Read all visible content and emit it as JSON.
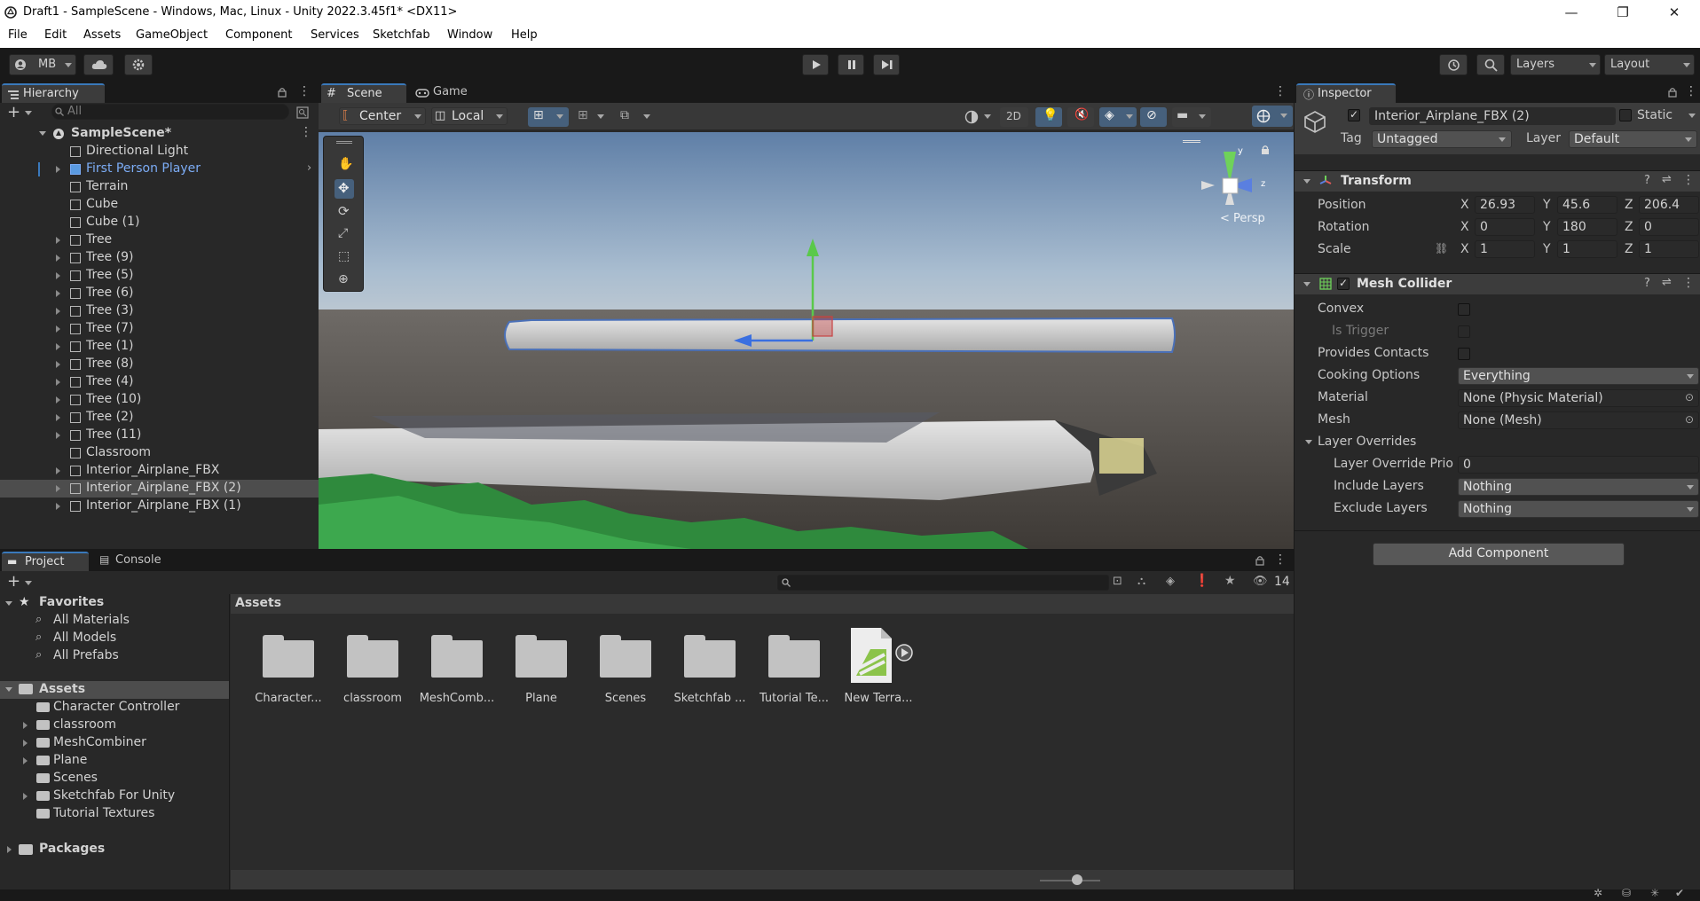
{
  "window": {
    "title": "Draft1 - SampleScene - Windows, Mac, Linux - Unity 2022.3.45f1* <DX11>"
  },
  "menu": [
    "File",
    "Edit",
    "Assets",
    "GameObject",
    "Component",
    "Services",
    "Sketchfab",
    "Window",
    "Help"
  ],
  "toolbar": {
    "account": "MB",
    "layers": "Layers",
    "layout": "Layout"
  },
  "hierarchy": {
    "tab": "Hierarchy",
    "search_placeholder": "All",
    "scene": "SampleScene*",
    "items": [
      {
        "label": "Directional Light",
        "arrow": false
      },
      {
        "label": "First Person Player",
        "arrow": true,
        "prefab": true
      },
      {
        "label": "Terrain",
        "arrow": false
      },
      {
        "label": "Cube",
        "arrow": false
      },
      {
        "label": "Cube (1)",
        "arrow": false
      },
      {
        "label": "Tree",
        "arrow": true
      },
      {
        "label": "Tree (9)",
        "arrow": true
      },
      {
        "label": "Tree (5)",
        "arrow": true
      },
      {
        "label": "Tree (6)",
        "arrow": true
      },
      {
        "label": "Tree (3)",
        "arrow": true
      },
      {
        "label": "Tree (7)",
        "arrow": true
      },
      {
        "label": "Tree (1)",
        "arrow": true
      },
      {
        "label": "Tree (8)",
        "arrow": true
      },
      {
        "label": "Tree (4)",
        "arrow": true
      },
      {
        "label": "Tree (10)",
        "arrow": true
      },
      {
        "label": "Tree (2)",
        "arrow": true
      },
      {
        "label": "Tree (11)",
        "arrow": true
      },
      {
        "label": "Classroom",
        "arrow": false
      },
      {
        "label": "Interior_Airplane_FBX",
        "arrow": true
      },
      {
        "label": "Interior_Airplane_FBX (2)",
        "arrow": true,
        "selected": true
      },
      {
        "label": "Interior_Airplane_FBX (1)",
        "arrow": true
      }
    ]
  },
  "scene_view": {
    "tabs": [
      "Scene",
      "Game"
    ],
    "pivot": "Center",
    "space": "Local",
    "mode_2d": "2D",
    "gizmo_label": "< Persp"
  },
  "inspector": {
    "tab": "Inspector",
    "object_name": "Interior_Airplane_FBX (2)",
    "static_label": "Static",
    "tag_label": "Tag",
    "tag_value": "Untagged",
    "layer_label": "Layer",
    "layer_value": "Default",
    "transform": {
      "title": "Transform",
      "position": {
        "label": "Position",
        "x": "26.93",
        "y": "45.6",
        "z": "206.4"
      },
      "rotation": {
        "label": "Rotation",
        "x": "0",
        "y": "180",
        "z": "0"
      },
      "scale": {
        "label": "Scale",
        "x": "1",
        "y": "1",
        "z": "1"
      }
    },
    "mesh_collider": {
      "title": "Mesh Collider",
      "convex": "Convex",
      "is_trigger": "Is Trigger",
      "provides_contacts": "Provides Contacts",
      "cooking_label": "Cooking Options",
      "cooking_value": "Everything",
      "material_label": "Material",
      "material_value": "None (Physic Material)",
      "mesh_label": "Mesh",
      "mesh_value": "None (Mesh)",
      "layer_overrides": "Layer Overrides",
      "priority_label": "Layer Override Prio",
      "priority_value": "0",
      "include_label": "Include Layers",
      "include_value": "Nothing",
      "exclude_label": "Exclude Layers",
      "exclude_value": "Nothing"
    },
    "add_component": "Add Component"
  },
  "project": {
    "tabs": [
      "Project",
      "Console"
    ],
    "hidden_count": "14",
    "favorites": "Favorites",
    "fav_items": [
      "All Materials",
      "All Models",
      "All Prefabs"
    ],
    "assets": "Assets",
    "asset_folders": [
      {
        "label": "Character Controller",
        "arrow": false
      },
      {
        "label": "classroom",
        "arrow": true
      },
      {
        "label": "MeshCombiner",
        "arrow": true
      },
      {
        "label": "Plane",
        "arrow": true
      },
      {
        "label": "Scenes",
        "arrow": false
      },
      {
        "label": "Sketchfab For Unity",
        "arrow": true
      },
      {
        "label": "Tutorial Textures",
        "arrow": false
      }
    ],
    "packages": "Packages",
    "breadcrumb": "Assets",
    "grid": [
      "Character...",
      "classroom",
      "MeshComb...",
      "Plane",
      "Scenes",
      "Sketchfab ...",
      "Tutorial Te...",
      "New Terra..."
    ]
  },
  "colors": {
    "accent": "#3a79bb",
    "selected_row": "#4d4d4d",
    "prefab_text": "#7cacf5"
  }
}
